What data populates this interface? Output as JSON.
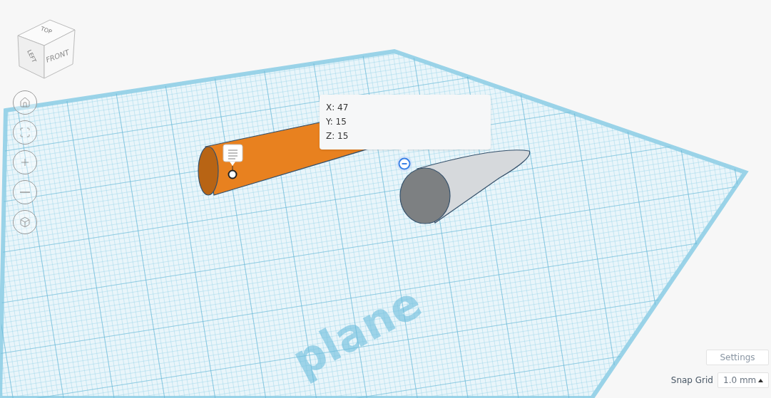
{
  "view_cube": {
    "top": "TOP",
    "left": "LEFT",
    "front": "FRONT"
  },
  "nav_buttons": [
    {
      "kind": "home"
    },
    {
      "kind": "fit"
    },
    {
      "kind": "zoom-in"
    },
    {
      "kind": "zoom-out"
    },
    {
      "kind": "perspective"
    }
  ],
  "workplane": {
    "label": "plane"
  },
  "tooltip": {
    "lines": [
      "X: 47",
      "Y: 15",
      "Z: 15"
    ]
  },
  "settings_button": "Settings",
  "snap_grid": {
    "label": "Snap Grid",
    "value": "1.0 mm"
  }
}
